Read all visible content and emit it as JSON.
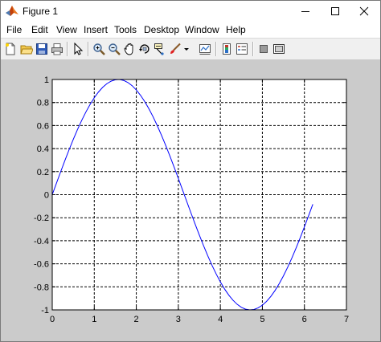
{
  "window": {
    "title": "Figure 1"
  },
  "menu": {
    "items": [
      "File",
      "Edit",
      "View",
      "Insert",
      "Tools",
      "Desktop",
      "Window",
      "Help"
    ]
  },
  "toolbar": {
    "buttons": [
      "new-figure-icon",
      "open-file-icon",
      "save-icon",
      "print-icon",
      "edit-plot-arrow-icon",
      "zoom-in-icon",
      "zoom-out-icon",
      "pan-hand-icon",
      "rotate-3d-icon",
      "data-cursor-icon",
      "brush-icon",
      "brush-dropdown-icon",
      "link-plot-icon",
      "insert-colorbar-icon",
      "insert-legend-icon",
      "hide-plot-tools-icon",
      "show-plot-tools-icon"
    ]
  },
  "colors": {
    "line": "#0000ff",
    "figure_background": "#cbcbcb",
    "axes_background": "#ffffff"
  },
  "chart_data": {
    "type": "line",
    "function": "sin(x)",
    "x_range": [
      0,
      6.2
    ],
    "x_step": 0.1,
    "xlim": [
      0,
      7
    ],
    "ylim": [
      -1,
      1
    ],
    "xticks": [
      "0",
      "1",
      "2",
      "3",
      "4",
      "5",
      "6",
      "7"
    ],
    "yticks": [
      "1",
      "0.8",
      "0.6",
      "0.4",
      "0.2",
      "0",
      "-0.2",
      "-0.4",
      "-0.6",
      "-0.8",
      "-1"
    ],
    "grid": true,
    "grid_style": "dashed",
    "title": "",
    "xlabel": "",
    "ylabel": ""
  }
}
